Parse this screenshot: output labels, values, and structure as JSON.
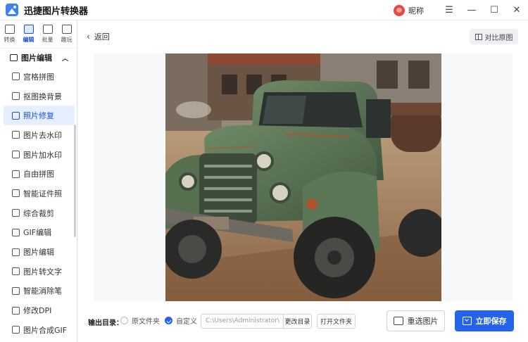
{
  "app": {
    "title": "迅捷图片转换器"
  },
  "user": {
    "nickname": "昵称"
  },
  "window_controls": {
    "menu": "☰",
    "minimize": "—",
    "maximize": "☐",
    "close": "✕"
  },
  "rail_tabs": [
    {
      "label": "转换",
      "active": false
    },
    {
      "label": "编辑",
      "active": true
    },
    {
      "label": "批量",
      "active": false
    },
    {
      "label": "趣玩",
      "active": false
    }
  ],
  "section": {
    "title": "图片编辑"
  },
  "menu_items": [
    {
      "label": "宫格拼图"
    },
    {
      "label": "抠图换背景"
    },
    {
      "label": "照片修复",
      "active": true
    },
    {
      "label": "图片去水印"
    },
    {
      "label": "图片加水印"
    },
    {
      "label": "自由拼图"
    },
    {
      "label": "智能证件照"
    },
    {
      "label": "综合裁剪"
    },
    {
      "label": "GIF编辑"
    },
    {
      "label": "图片编辑"
    },
    {
      "label": "图片转文字"
    },
    {
      "label": "智能消除笔"
    },
    {
      "label": "修改DPI"
    },
    {
      "label": "图片合成GIF"
    }
  ],
  "topbar": {
    "back_label": "返回",
    "compare_label": "对比原图"
  },
  "bottom": {
    "output_label": "输出目录：",
    "option_original": "原文件夹",
    "option_custom": "自定义",
    "path_value": "C:\\Users\\Administrator\\",
    "change_dir": "更改目录",
    "open_folder": "打开文件夹",
    "reselect": "重选图片",
    "save": "立即保存"
  },
  "colors": {
    "accent": "#2563eb",
    "active_bg": "#e6efff"
  }
}
